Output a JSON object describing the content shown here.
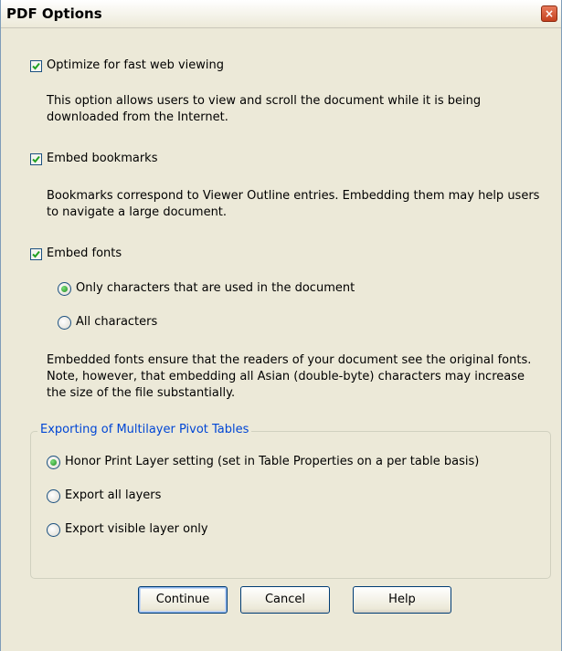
{
  "window": {
    "title": "PDF Options",
    "close_glyph": "×"
  },
  "options": {
    "optimize_web": {
      "label": "Optimize for fast web viewing",
      "checked": true,
      "description": "This option allows users to view and scroll the document while it is being downloaded from the Internet."
    },
    "embed_bookmarks": {
      "label": "Embed bookmarks",
      "checked": true,
      "description": "Bookmarks correspond to Viewer Outline entries. Embedding them may help users to navigate a large document."
    },
    "embed_fonts": {
      "label": "Embed fonts",
      "checked": true,
      "choices": [
        {
          "label": "Only characters that are used in the document",
          "selected": true
        },
        {
          "label": "All characters",
          "selected": false
        }
      ],
      "description": "Embedded fonts ensure that the readers of your document see the original fonts. Note, however, that embedding all Asian (double-byte) characters may increase the size of the file substantially."
    }
  },
  "pivot_group": {
    "legend": "Exporting of Multilayer Pivot Tables",
    "choices": [
      {
        "label": "Honor Print Layer setting (set in Table Properties on a per table basis)",
        "selected": true
      },
      {
        "label": "Export all layers",
        "selected": false
      },
      {
        "label": "Export visible layer only",
        "selected": false
      }
    ]
  },
  "buttons": {
    "continue_label": "Continue",
    "cancel_label": "Cancel",
    "help_label": "Help"
  },
  "colors": {
    "dialog_background": "#ece9d8",
    "group_legend": "#0046d5",
    "check_mark": "#21a121",
    "close_button": "#d4502b"
  },
  "icons": {
    "close": "close-icon",
    "check": "checkmark-icon",
    "radio": "radio-dot-icon"
  }
}
